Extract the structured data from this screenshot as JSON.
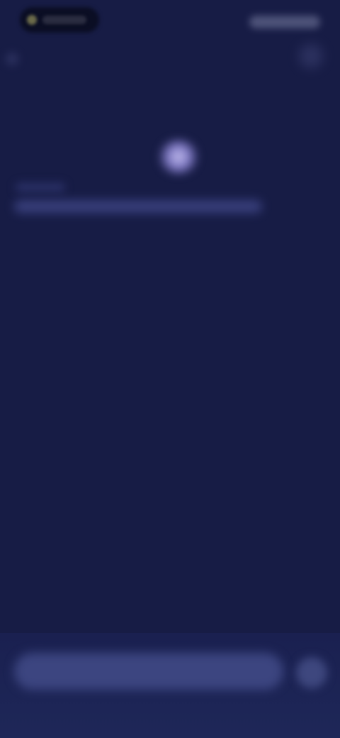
{
  "status_bar": {
    "pill_icon": "mic-indicator-icon",
    "icons": "signal-wifi-battery-icon"
  },
  "header": {
    "back_icon": "back-arrow-icon",
    "menu_icon": "more-options-icon",
    "title": ""
  },
  "main": {
    "orb_icon": "assistant-orb-icon",
    "sub_label": "",
    "description": ""
  },
  "composer": {
    "placeholder": "",
    "send_icon": "send-icon"
  },
  "colors": {
    "background": "#171c45",
    "bottom_bar": "#1e2758",
    "input": "#3c4580",
    "orb": "#c6c2ee"
  }
}
